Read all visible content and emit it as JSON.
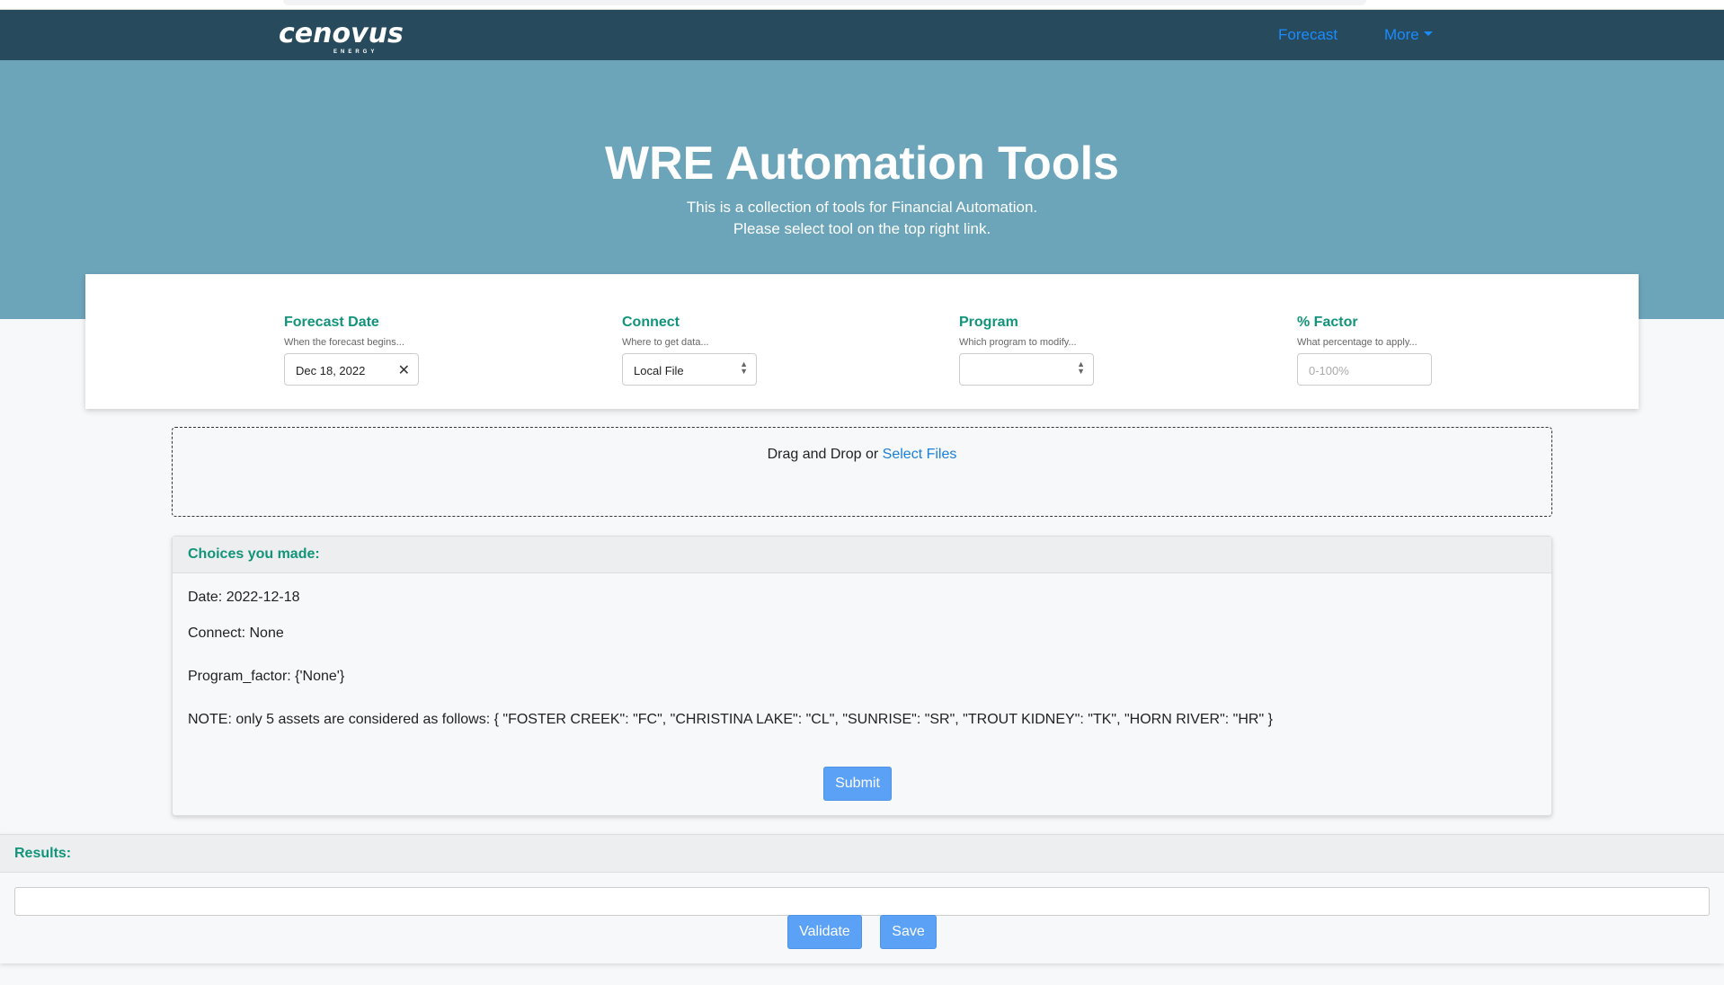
{
  "navbar": {
    "logo_text": "cenovus",
    "logo_subtext": "ENERGY",
    "links": {
      "forecast": "Forecast",
      "more": "More"
    }
  },
  "hero": {
    "title": "WRE Automation Tools",
    "line1": "This is a collection of tools for Financial Automation.",
    "line2": "Please select tool on the top right link."
  },
  "controls": {
    "forecast_date": {
      "label": "Forecast Date",
      "help": "When the forecast begins...",
      "value": "Dec 18, 2022"
    },
    "connect": {
      "label": "Connect",
      "help": "Where to get data...",
      "value": "Local File"
    },
    "program": {
      "label": "Program",
      "help": "Which program to modify...",
      "value": ""
    },
    "factor": {
      "label": "% Factor",
      "help": "What percentage to apply...",
      "placeholder": "0-100%"
    }
  },
  "dropzone": {
    "text": "Drag and Drop or ",
    "link": "Select Files"
  },
  "choices": {
    "title": "Choices you made:",
    "date": "Date: 2022-12-18",
    "connect": "Connect: None",
    "program_factor": "Program_factor: {'None'}",
    "note": "NOTE: only 5 assets are considered as follows: { \"FOSTER CREEK\": \"FC\", \"CHRISTINA LAKE\": \"CL\", \"SUNRISE\": \"SR\", \"TROUT KIDNEY\": \"TK\", \"HORN RIVER\": \"HR\" }",
    "submit_label": "Submit"
  },
  "results": {
    "title": "Results:",
    "validate_label": "Validate",
    "save_label": "Save"
  },
  "colors": {
    "navbar": "#274a5c",
    "hero": "#6ca5ba",
    "accent_text": "#12947a",
    "link": "#1a8cff",
    "button": "#5ba1f5"
  }
}
